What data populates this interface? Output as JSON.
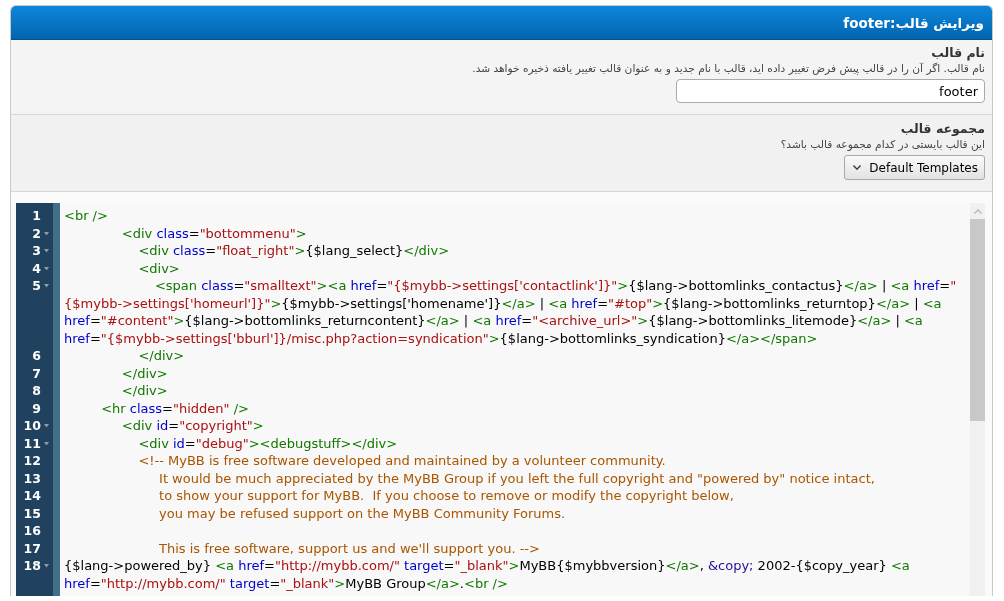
{
  "header": {
    "title": "ویرایش قالب:footer"
  },
  "fields": [
    {
      "kind": "text",
      "label": "نام قالب",
      "description": "نام قالب. اگر آن را در قالب پیش فرض تغییر داده اید، قالب با نام جدید و به عنوان قالب تغییر یافته ذخیره خواهد شد.",
      "value": "footer"
    },
    {
      "kind": "select",
      "label": "مجموعه قالب",
      "description": "این قالب بایستی در کدام مجموعه قالب باشد؟",
      "value": "Default Templates"
    }
  ],
  "editor": {
    "lines": [
      {
        "number": "1",
        "foldable": false,
        "wraps": [
          {
            "tokens": [
              {
                "kind": "tag",
                "text": "<br />"
              }
            ]
          }
        ]
      },
      {
        "number": "2",
        "foldable": true,
        "wraps": [
          {
            "tokens": [
              {
                "kind": "tag",
                "text": "              <div "
              },
              {
                "kind": "attribute",
                "text": "class"
              },
              {
                "kind": "text",
                "text": "="
              },
              {
                "kind": "string",
                "text": "\"bottommenu\""
              },
              {
                "kind": "tag",
                "text": ">"
              }
            ]
          }
        ]
      },
      {
        "number": "3",
        "foldable": true,
        "wraps": [
          {
            "tokens": [
              {
                "kind": "tag",
                "text": "                  <div "
              },
              {
                "kind": "attribute",
                "text": "class"
              },
              {
                "kind": "text",
                "text": "="
              },
              {
                "kind": "string",
                "text": "\"float_right\""
              },
              {
                "kind": "tag",
                "text": ">"
              },
              {
                "kind": "text",
                "text": "{$lang_select}"
              },
              {
                "kind": "tag",
                "text": "</div>"
              }
            ]
          }
        ]
      },
      {
        "number": "4",
        "foldable": true,
        "wraps": [
          {
            "tokens": [
              {
                "kind": "tag",
                "text": "                  <div>"
              }
            ]
          }
        ]
      },
      {
        "number": "5",
        "foldable": true,
        "wraps": [
          {
            "tokens": [
              {
                "kind": "tag",
                "text": "                      <span "
              },
              {
                "kind": "attribute",
                "text": "class"
              },
              {
                "kind": "text",
                "text": "="
              },
              {
                "kind": "string",
                "text": "\"smalltext\""
              },
              {
                "kind": "tag",
                "text": "><a "
              },
              {
                "kind": "attribute",
                "text": "href"
              },
              {
                "kind": "text",
                "text": "="
              },
              {
                "kind": "string",
                "text": "\"{$mybb->settings['contactlink']}\""
              },
              {
                "kind": "tag",
                "text": ">"
              },
              {
                "kind": "text",
                "text": "{$lang->bottomlinks_contactus}"
              },
              {
                "kind": "tag",
                "text": "</a>"
              },
              {
                "kind": "text",
                "text": " | "
              },
              {
                "kind": "tag",
                "text": "<a "
              },
              {
                "kind": "attribute",
                "text": "href"
              },
              {
                "kind": "text",
                "text": "="
              },
              {
                "kind": "string",
                "text": "\""
              }
            ]
          },
          {
            "tokens": [
              {
                "kind": "string",
                "text": "{$mybb->settings['homeurl']}\""
              },
              {
                "kind": "tag",
                "text": ">"
              },
              {
                "kind": "text",
                "text": "{$mybb->settings['homename']}"
              },
              {
                "kind": "tag",
                "text": "</a>"
              },
              {
                "kind": "text",
                "text": " | "
              },
              {
                "kind": "tag",
                "text": "<a "
              },
              {
                "kind": "attribute",
                "text": "href"
              },
              {
                "kind": "text",
                "text": "="
              },
              {
                "kind": "string",
                "text": "\"#top\""
              },
              {
                "kind": "tag",
                "text": ">"
              },
              {
                "kind": "text",
                "text": "{$lang->bottomlinks_returntop}"
              },
              {
                "kind": "tag",
                "text": "</a>"
              },
              {
                "kind": "text",
                "text": " | "
              },
              {
                "kind": "tag",
                "text": "<a"
              }
            ]
          },
          {
            "tokens": [
              {
                "kind": "attribute",
                "text": "href"
              },
              {
                "kind": "text",
                "text": "="
              },
              {
                "kind": "string",
                "text": "\"#content\""
              },
              {
                "kind": "tag",
                "text": ">"
              },
              {
                "kind": "text",
                "text": "{$lang->bottomlinks_returncontent}"
              },
              {
                "kind": "tag",
                "text": "</a>"
              },
              {
                "kind": "text",
                "text": " | "
              },
              {
                "kind": "tag",
                "text": "<a "
              },
              {
                "kind": "attribute",
                "text": "href"
              },
              {
                "kind": "text",
                "text": "="
              },
              {
                "kind": "string",
                "text": "\"<archive_url>\""
              },
              {
                "kind": "tag",
                "text": ">"
              },
              {
                "kind": "text",
                "text": "{$lang->bottomlinks_litemode}"
              },
              {
                "kind": "tag",
                "text": "</a>"
              },
              {
                "kind": "text",
                "text": " | "
              },
              {
                "kind": "tag",
                "text": "<a"
              }
            ]
          },
          {
            "tokens": [
              {
                "kind": "attribute",
                "text": "href"
              },
              {
                "kind": "text",
                "text": "="
              },
              {
                "kind": "string",
                "text": "\"{$mybb->settings['bburl']}/misc.php?action=syndication\""
              },
              {
                "kind": "tag",
                "text": ">"
              },
              {
                "kind": "text",
                "text": "{$lang->bottomlinks_syndication}"
              },
              {
                "kind": "tag",
                "text": "</a></span>"
              }
            ]
          }
        ]
      },
      {
        "number": "6",
        "foldable": false,
        "wraps": [
          {
            "tokens": [
              {
                "kind": "tag",
                "text": "                  </div>"
              }
            ]
          }
        ]
      },
      {
        "number": "7",
        "foldable": false,
        "wraps": [
          {
            "tokens": [
              {
                "kind": "tag",
                "text": "              </div>"
              }
            ]
          }
        ]
      },
      {
        "number": "8",
        "foldable": false,
        "wraps": [
          {
            "tokens": [
              {
                "kind": "tag",
                "text": "              </div>"
              }
            ]
          }
        ]
      },
      {
        "number": "9",
        "foldable": false,
        "wraps": [
          {
            "tokens": [
              {
                "kind": "tag",
                "text": "         <hr "
              },
              {
                "kind": "attribute",
                "text": "class"
              },
              {
                "kind": "text",
                "text": "="
              },
              {
                "kind": "string",
                "text": "\"hidden\""
              },
              {
                "kind": "tag",
                "text": " />"
              }
            ]
          }
        ]
      },
      {
        "number": "10",
        "foldable": true,
        "wraps": [
          {
            "tokens": [
              {
                "kind": "tag",
                "text": "              <div "
              },
              {
                "kind": "attribute",
                "text": "id"
              },
              {
                "kind": "text",
                "text": "="
              },
              {
                "kind": "string",
                "text": "\"copyright\""
              },
              {
                "kind": "tag",
                "text": ">"
              }
            ]
          }
        ]
      },
      {
        "number": "11",
        "foldable": true,
        "wraps": [
          {
            "tokens": [
              {
                "kind": "tag",
                "text": "                  <div "
              },
              {
                "kind": "attribute",
                "text": "id"
              },
              {
                "kind": "text",
                "text": "="
              },
              {
                "kind": "string",
                "text": "\"debug\""
              },
              {
                "kind": "tag",
                "text": "><debugstuff></div>"
              }
            ]
          }
        ]
      },
      {
        "number": "12",
        "foldable": false,
        "wraps": [
          {
            "tokens": [
              {
                "kind": "comment",
                "text": "                  <!-- MyBB is free software developed and maintained by a volunteer community."
              }
            ]
          }
        ]
      },
      {
        "number": "13",
        "foldable": false,
        "wraps": [
          {
            "tokens": [
              {
                "kind": "comment",
                "text": "                       It would be much appreciated by the MyBB Group if you left the full copyright and \"powered by\" notice intact,"
              }
            ]
          }
        ]
      },
      {
        "number": "14",
        "foldable": false,
        "wraps": [
          {
            "tokens": [
              {
                "kind": "comment",
                "text": "                       to show your support for MyBB.  If you choose to remove or modify the copyright below,"
              }
            ]
          }
        ]
      },
      {
        "number": "15",
        "foldable": false,
        "wraps": [
          {
            "tokens": [
              {
                "kind": "comment",
                "text": "                       you may be refused support on the MyBB Community Forums."
              }
            ]
          }
        ]
      },
      {
        "number": "16",
        "foldable": false
      },
      {
        "number": "17",
        "foldable": false,
        "wraps": [
          {
            "tokens": [
              {
                "kind": "comment",
                "text": "                       This is free software, support us and we'll support you. -->"
              }
            ]
          }
        ]
      },
      {
        "number": "18",
        "foldable": true,
        "wraps": [
          {
            "tokens": [
              {
                "kind": "text",
                "text": "{$lang->powered_by} "
              },
              {
                "kind": "tag",
                "text": "<a "
              },
              {
                "kind": "attribute",
                "text": "href"
              },
              {
                "kind": "text",
                "text": "="
              },
              {
                "kind": "string",
                "text": "\"http://mybb.com/\""
              },
              {
                "kind": "attribute",
                "text": " target"
              },
              {
                "kind": "text",
                "text": "="
              },
              {
                "kind": "string",
                "text": "\"_blank\""
              },
              {
                "kind": "tag",
                "text": ">"
              },
              {
                "kind": "text",
                "text": "MyBB{$mybbversion}"
              },
              {
                "kind": "tag",
                "text": "</a>"
              },
              {
                "kind": "text",
                "text": ", "
              },
              {
                "kind": "entity",
                "text": "&copy;"
              },
              {
                "kind": "text",
                "text": " 2002-{$copy_year} "
              },
              {
                "kind": "tag",
                "text": "<a"
              }
            ]
          },
          {
            "tokens": [
              {
                "kind": "attribute",
                "text": "href"
              },
              {
                "kind": "text",
                "text": "="
              },
              {
                "kind": "string",
                "text": "\"http://mybb.com/\""
              },
              {
                "kind": "attribute",
                "text": " target"
              },
              {
                "kind": "text",
                "text": "="
              },
              {
                "kind": "string",
                "text": "\"_blank\""
              },
              {
                "kind": "tag",
                "text": ">"
              },
              {
                "kind": "text",
                "text": "MyBB Group"
              },
              {
                "kind": "tag",
                "text": "</a>"
              },
              {
                "kind": "text",
                "text": "."
              },
              {
                "kind": "tag",
                "text": "<br />"
              }
            ]
          }
        ]
      }
    ]
  }
}
